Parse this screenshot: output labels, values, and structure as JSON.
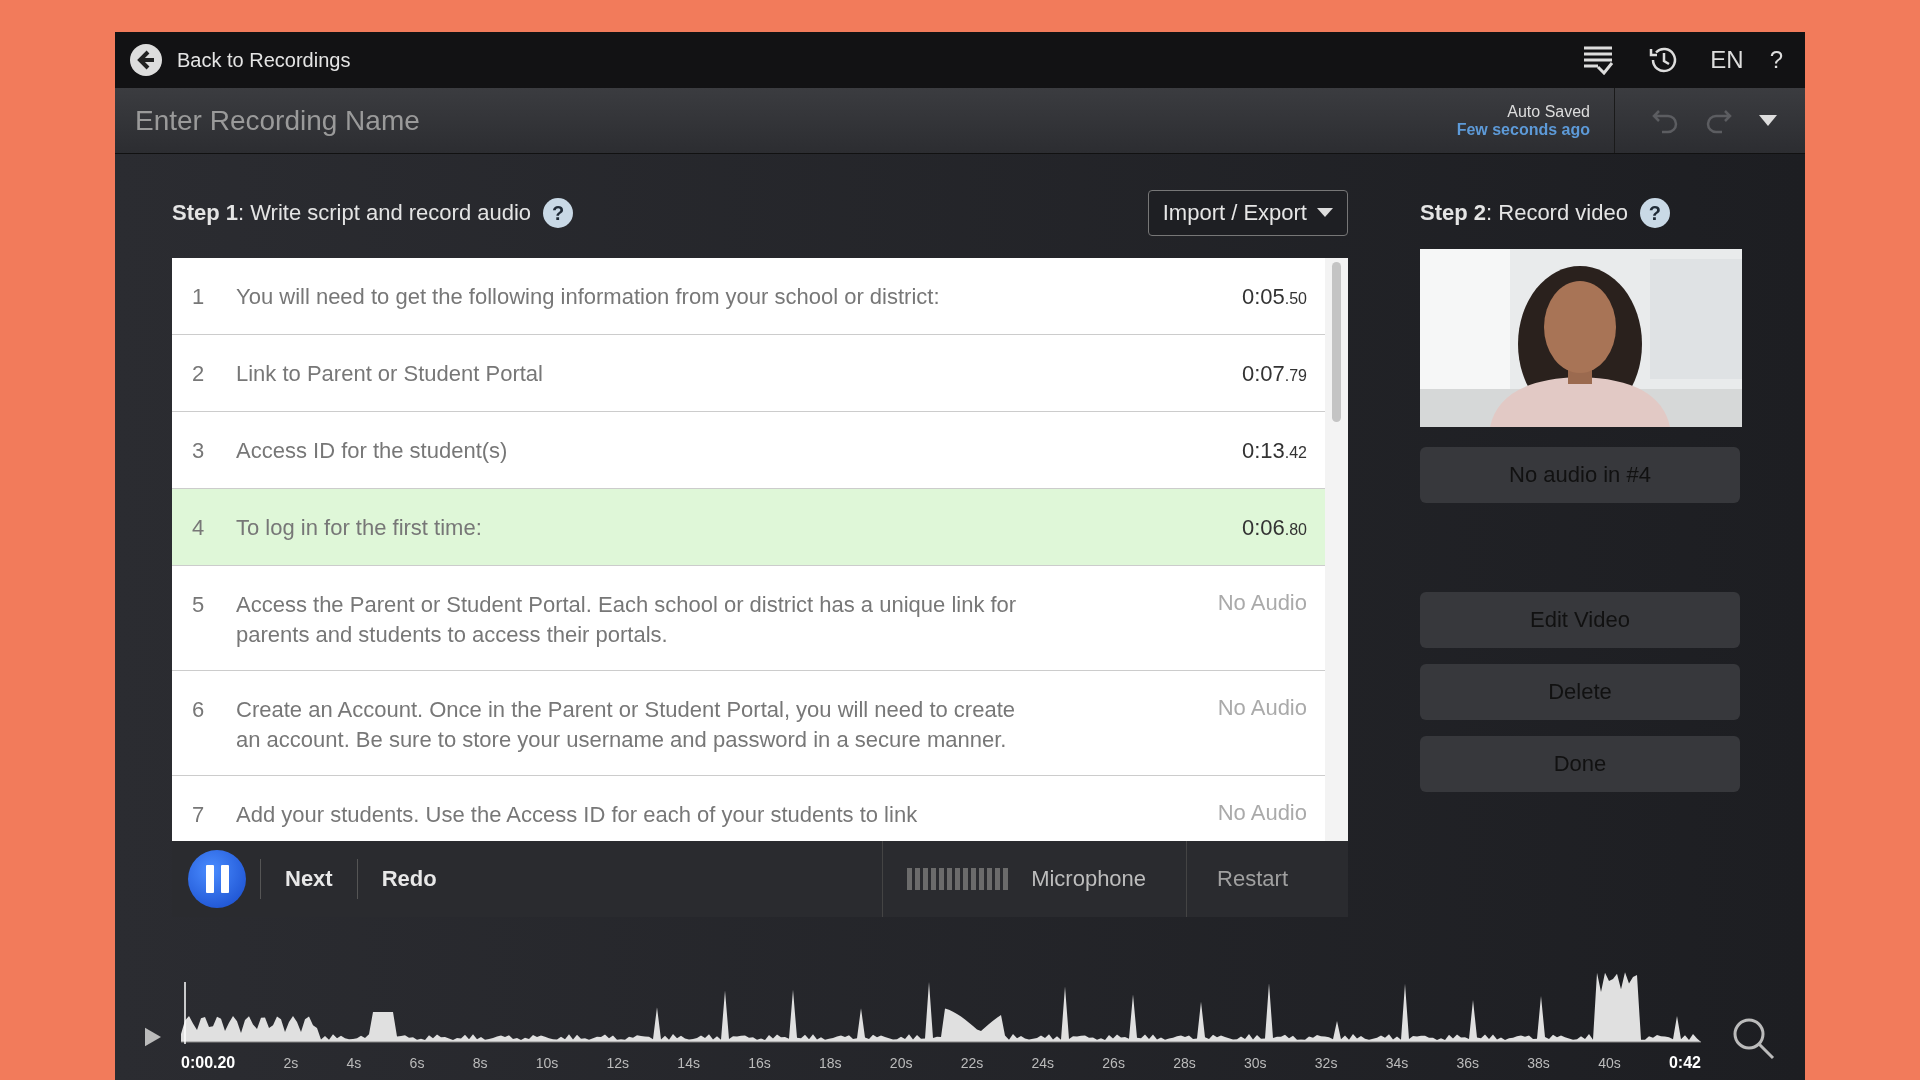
{
  "top_bar": {
    "back_label": "Back to Recordings",
    "language": "EN",
    "help": "?"
  },
  "name_bar": {
    "placeholder": "Enter Recording Name",
    "save_status": "Auto Saved",
    "save_time": "Few seconds ago"
  },
  "step1": {
    "label": "Step 1",
    "title": ": Write script and record audio",
    "help": "?",
    "import_export": "Import / Export"
  },
  "script_rows": [
    {
      "number": "1",
      "text": "You will need to get the following information from your school or district:",
      "time": "0:05",
      "fraction": ".50",
      "selected": false
    },
    {
      "number": "2",
      "text": "Link to Parent or Student Portal",
      "time": "0:07",
      "fraction": ".79",
      "selected": false
    },
    {
      "number": "3",
      "text": "Access ID for the student(s)",
      "time": "0:13",
      "fraction": ".42",
      "selected": false
    },
    {
      "number": "4",
      "text": "To log in for the first time:",
      "time": "0:06",
      "fraction": ".80",
      "selected": true
    },
    {
      "number": "5",
      "text": "Access the Parent or Student Portal. Each school or district has a unique link for parents and students to access their portals.",
      "no_audio": "No Audio",
      "selected": false
    },
    {
      "number": "6",
      "text": "Create an Account. Once in the Parent or Student Portal, you will need to create an account. Be sure to store your username and password in a secure manner.",
      "no_audio": "No Audio",
      "selected": false
    },
    {
      "number": "7",
      "text": "Add your students. Use the Access ID for each of your students to link",
      "no_audio": "No Audio",
      "selected": false
    }
  ],
  "controls": {
    "next": "Next",
    "redo": "Redo",
    "microphone": "Microphone",
    "restart": "Restart"
  },
  "step2": {
    "label": "Step 2",
    "title": ": Record video",
    "help": "?",
    "status": "No audio in #4",
    "buttons": [
      "Edit Video",
      "Delete",
      "Done"
    ]
  },
  "timeline": {
    "current_time": "0:00.20",
    "ticks": [
      "2s",
      "4s",
      "6s",
      "8s",
      "10s",
      "12s",
      "14s",
      "16s",
      "18s",
      "20s",
      "22s",
      "24s",
      "26s",
      "28s",
      "30s",
      "32s",
      "34s",
      "36s",
      "38s",
      "40s"
    ],
    "end_time": "0:42"
  }
}
